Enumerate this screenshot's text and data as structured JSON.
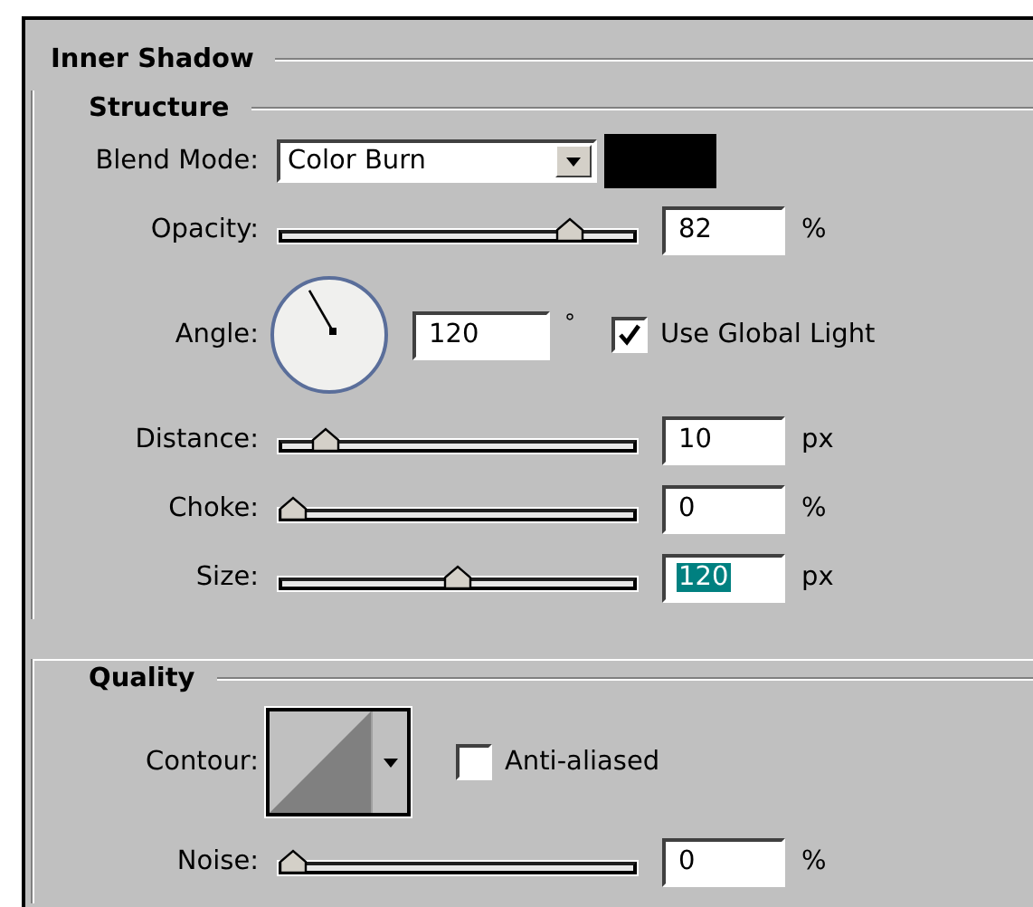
{
  "panel": {
    "title": "Inner Shadow"
  },
  "groups": [
    {
      "title": "Structure",
      "rows": [
        {
          "kind": "select",
          "label": "Blend Mode:",
          "value": "Color Burn",
          "color": "#000000"
        },
        {
          "kind": "slider",
          "label": "Opacity:",
          "level": 0.84,
          "value": "82",
          "unit": "%",
          "text_selected": false
        },
        {
          "kind": "angle",
          "label": "Angle:",
          "value": "120",
          "unit": "°",
          "checkbox": {
            "label": "Use Global Light",
            "checked": true
          }
        },
        {
          "kind": "slider",
          "label": "Distance:",
          "level": 0.1,
          "value": "10",
          "unit": "px",
          "text_selected": false
        },
        {
          "kind": "slider",
          "label": "Choke:",
          "level": 0,
          "value": "0",
          "unit": "%",
          "text_selected": false
        },
        {
          "kind": "slider",
          "label": "Size:",
          "level": 0.5,
          "value": "120",
          "unit": "px",
          "text_selected": true
        }
      ]
    },
    {
      "title": "Quality",
      "rows": [
        {
          "kind": "contour",
          "label": "Contour:",
          "checkbox": {
            "label": "Anti-aliased",
            "checked": false
          }
        },
        {
          "kind": "slider",
          "label": "Noise:",
          "level": 0,
          "value": "0",
          "unit": "%",
          "text_selected": false
        }
      ]
    }
  ]
}
